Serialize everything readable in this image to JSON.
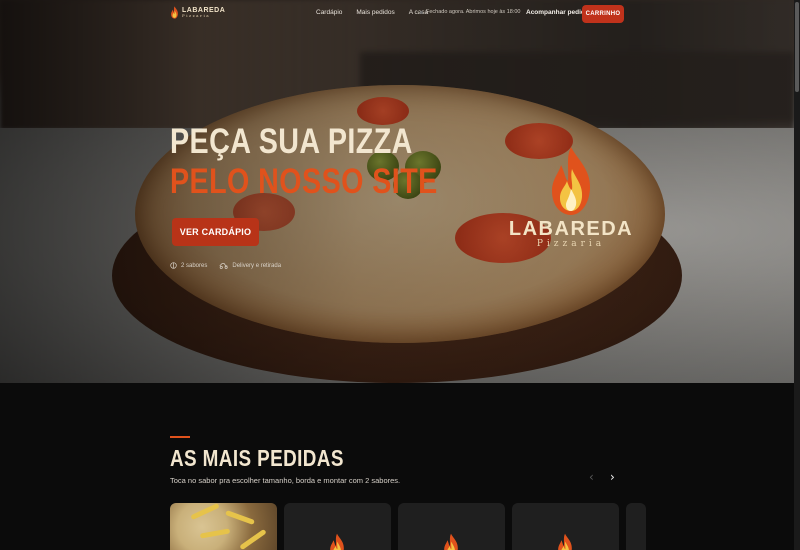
{
  "brand": {
    "name": "LABAREDA",
    "subtitle": "Pizzaria",
    "accent_color": "#e0521c",
    "button_color": "#b83318"
  },
  "nav": {
    "links": [
      "Cardápio",
      "Mais pedidos",
      "A casa"
    ],
    "status": "Fechado agora. Abrimos hoje às 18:00",
    "track_order": "Acompanhar pedido",
    "cart_label": "CARRINHO"
  },
  "hero": {
    "title_line1": "PEÇA SUA PIZZA",
    "title_line2": "PELO NOSSO SITE",
    "cta_label": "VER CARDÁPIO",
    "features": [
      {
        "icon": "pizza-slice-icon",
        "label": "2 sabores"
      },
      {
        "icon": "delivery-icon",
        "label": "Delivery e retirada"
      }
    ],
    "logo_word": "LABAREDA",
    "logo_sub": "Pizzaria"
  },
  "section": {
    "title": "AS MAIS PEDIDAS",
    "subtitle": "Toca no sabor pra escolher tamanho, borda e montar com 2 sabores.",
    "prev_icon": "‹",
    "next_icon": "›"
  }
}
